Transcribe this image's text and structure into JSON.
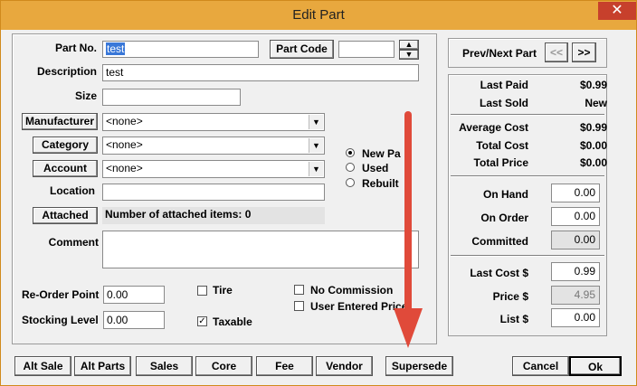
{
  "window": {
    "title": "Edit Part",
    "close_glyph": "✕"
  },
  "form": {
    "part_no_label": "Part No.",
    "part_no_value": "test",
    "part_code_button": "Part Code",
    "part_code_value": "",
    "description_label": "Description",
    "description_value": "test",
    "size_label": "Size",
    "size_value": "",
    "manufacturer_button": "Manufacturer",
    "manufacturer_value": "<none>",
    "category_button": "Category",
    "category_value": "<none>",
    "account_button": "Account",
    "account_value": "<none>",
    "location_label": "Location",
    "location_value": "",
    "attached_button": "Attached",
    "attached_text": "Number of attached items: 0",
    "comment_label": "Comment",
    "comment_value": "",
    "reorder_label": "Re-Order Point",
    "reorder_value": "0.00",
    "stocking_label": "Stocking Level",
    "stocking_value": "0.00"
  },
  "condition": {
    "options": [
      "New Pa",
      "Used",
      "Rebuilt"
    ],
    "selected": "New Pa"
  },
  "checks": {
    "tire": {
      "label": "Tire",
      "checked": false
    },
    "taxable": {
      "label": "Taxable",
      "checked": true
    },
    "no_commission": {
      "label": "No Commission",
      "checked": false
    },
    "user_price": {
      "label": "User Entered Price",
      "checked": false
    }
  },
  "nav": {
    "label": "Prev/Next Part",
    "prev": "<<",
    "next": ">>"
  },
  "summary": {
    "last_paid_label": "Last Paid",
    "last_paid": "$0.99",
    "last_sold_label": "Last Sold",
    "last_sold": "New",
    "avg_cost_label": "Average Cost",
    "avg_cost": "$0.99",
    "total_cost_label": "Total Cost",
    "total_cost": "$0.00",
    "total_price_label": "Total Price",
    "total_price": "$0.00",
    "on_hand_label": "On Hand",
    "on_hand": "0.00",
    "on_order_label": "On Order",
    "on_order": "0.00",
    "committed_label": "Committed",
    "committed": "0.00",
    "last_cost_label": "Last Cost $",
    "last_cost": "0.99",
    "price_label": "Price $",
    "price": "4.95",
    "list_label": "List $",
    "list": "0.00"
  },
  "footer": {
    "alt_sale": "Alt Sale",
    "alt_parts": "Alt Parts",
    "sales": "Sales",
    "core": "Core",
    "fee": "Fee",
    "vendor": "Vendor",
    "supersede": "Supersede",
    "cancel": "Cancel",
    "ok": "Ok"
  },
  "colors": {
    "titlebar": "#e8a83e",
    "close": "#c7402c",
    "annotation_arrow": "#e04a3a"
  }
}
